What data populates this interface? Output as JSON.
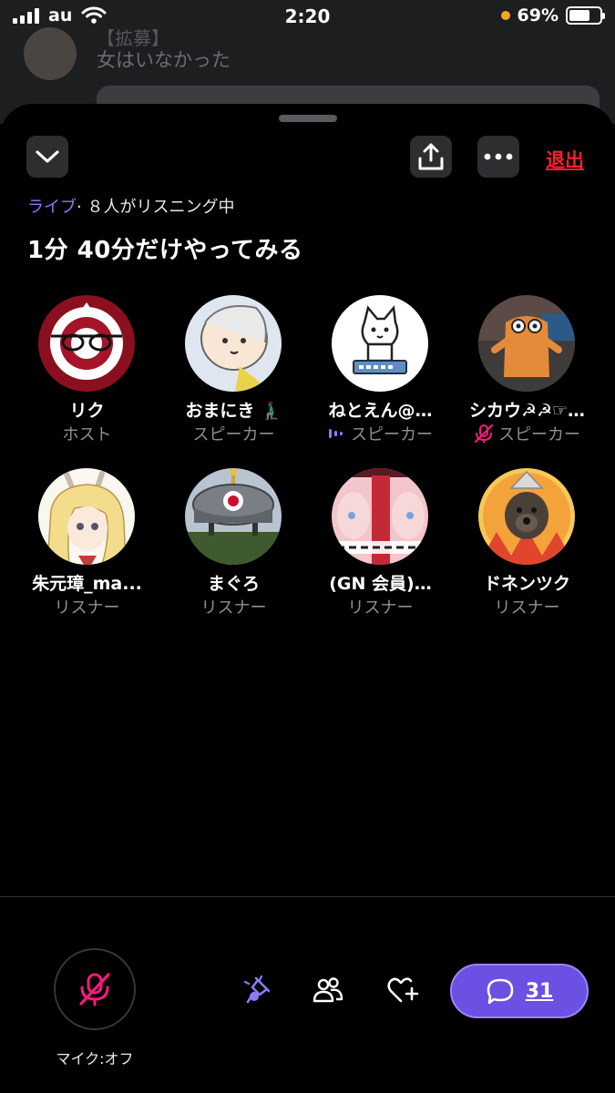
{
  "status_bar": {
    "carrier": "au",
    "time": "2:20",
    "battery": "69%",
    "battery_level": 0.69
  },
  "background": {
    "label": "【拡募】",
    "text": "女はいなかった"
  },
  "header": {
    "leave_label": "退出"
  },
  "space": {
    "live_tag": "ライブ",
    "listener_count": "· ８人がリスニング中",
    "title": "1分 40分だけやってみる"
  },
  "participants": [
    {
      "name": "リク",
      "role": "ホスト"
    },
    {
      "name": "おまにき 🧎🏿‍♂️",
      "role": "スピーカー"
    },
    {
      "name": "ねとえん@…",
      "role": "スピーカー",
      "status": "speaking"
    },
    {
      "name": "シカウ☭☭☞…",
      "role": "スピーカー",
      "status": "muted"
    },
    {
      "name": "朱元璋_ma...",
      "role": "リスナー"
    },
    {
      "name": "まぐろ",
      "role": "リスナー"
    },
    {
      "name": "(GN 会員)…",
      "role": "リスナー"
    },
    {
      "name": "ドネンツク",
      "role": "リスナー"
    }
  ],
  "footer": {
    "mic_label": "マイク:オフ",
    "chat_count": "31"
  },
  "colors": {
    "accent": "#6c4fe3",
    "live": "#8a7cf6",
    "danger": "#f4212e",
    "muted": "#f91880"
  },
  "icons": [
    "chevron-down-icon",
    "share-icon",
    "more-icon",
    "mic-off-icon",
    "pin-icon",
    "people-icon",
    "heart-plus-icon",
    "chat-icon",
    "speaking-icon"
  ]
}
